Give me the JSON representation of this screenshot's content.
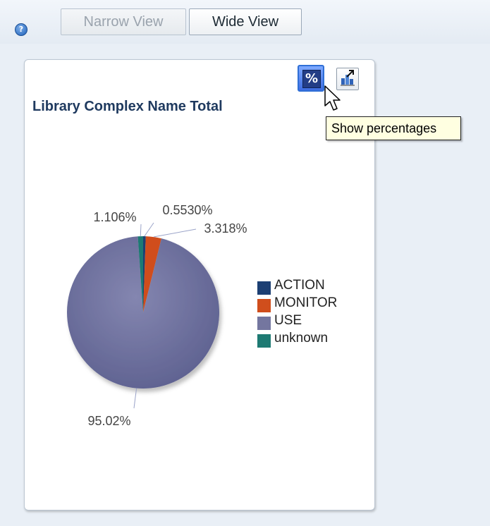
{
  "toolbar": {
    "help_icon": "question-icon",
    "help_glyph": "?",
    "narrow_view_label": "Narrow View",
    "wide_view_label": "Wide View"
  },
  "panel": {
    "show_percentages_icon": "percent-icon",
    "show_percentages_glyph": "%",
    "chart_options_icon": "chart-expand-icon",
    "tooltip": "Show percentages"
  },
  "colors": {
    "ACTION": "#1c3f73",
    "MONITOR": "#d04e1c",
    "USE": "#74769f",
    "unknown": "#1e7a73"
  },
  "chart_data": {
    "type": "pie",
    "title": "Library Complex Name Total",
    "slices": [
      {
        "label": "ACTION",
        "value": 0.553,
        "display": "0.5530%"
      },
      {
        "label": "MONITOR",
        "value": 3.318,
        "display": "3.318%"
      },
      {
        "label": "USE",
        "value": 95.02,
        "display": "95.02%"
      },
      {
        "label": "unknown",
        "value": 1.106,
        "display": "1.106%"
      }
    ],
    "legend": [
      "ACTION",
      "MONITOR",
      "USE",
      "unknown"
    ],
    "legend_position": "right"
  }
}
